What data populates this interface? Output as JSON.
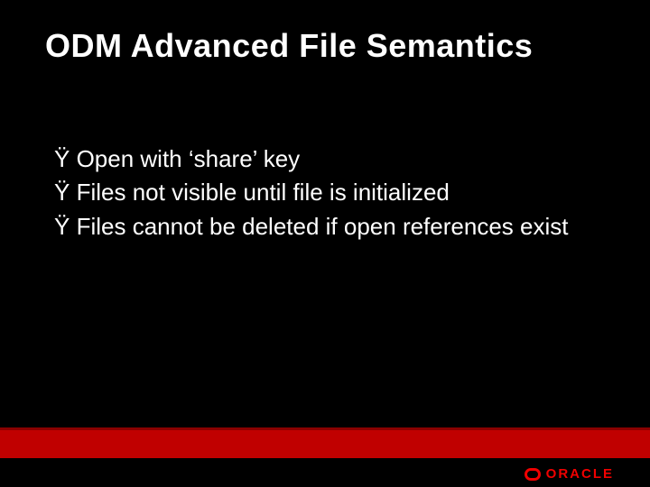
{
  "title": "ODM Advanced File Semantics",
  "bullets": [
    {
      "mark": "Ÿ",
      "text": "Open with ‘share’ key"
    },
    {
      "mark": "Ÿ",
      "text": "Files not visible until file is initialized"
    },
    {
      "mark": "Ÿ",
      "text": "Files cannot be deleted if open references exist"
    }
  ],
  "logo": {
    "word": "ORACLE"
  }
}
